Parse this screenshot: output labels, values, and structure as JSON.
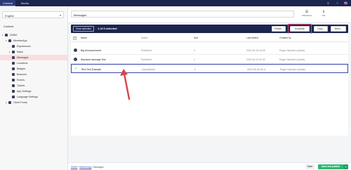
{
  "topbar": {
    "tabs": [
      "Content",
      "Media"
    ],
    "user_initials": "RH"
  },
  "sidebar": {
    "language": "English",
    "section_title": "Content",
    "items": [
      {
        "label": "DMNX"
      },
      {
        "label": "MemberApp"
      },
      {
        "label": "Experiences"
      },
      {
        "label": "Maps"
      },
      {
        "label": "Messages"
      },
      {
        "label": "Locations"
      },
      {
        "label": "Badges"
      },
      {
        "label": "Beacons"
      },
      {
        "label": "Events"
      },
      {
        "label": "Tickets"
      },
      {
        "label": "App Settings"
      },
      {
        "label": "Language Settings"
      },
      {
        "label": "Client Portal"
      }
    ]
  },
  "header": {
    "node_name": "Messages",
    "child_items_label": "Child items",
    "info_label": "Info"
  },
  "selection_bar": {
    "clear_label": "Clear selection",
    "count_text": "1 of 3 selected",
    "actions": [
      "Publish...",
      "Unpublish",
      "Copy...",
      "Move..."
    ]
  },
  "table": {
    "columns": [
      "Name",
      "Status",
      "Sort",
      "Last edited",
      "Created by"
    ],
    "rows": [
      {
        "name": "Big Announcement!",
        "status": "Published",
        "sort": "0",
        "last_edited": "2022-05-18 16:05",
        "created_by": "Roger Hamilton (Admin)"
      },
      {
        "name": "Standard message Test",
        "status": "Published",
        "sort": "1",
        "last_edited": "2022-05-13 20:32",
        "created_by": "Roger Hamilton (Admin)"
      },
      {
        "name": "Rich Text Example",
        "status": "Unpublished",
        "sort": "2",
        "last_edited": "2022-08-08 16:11",
        "created_by": "Roger Hamilton (Admin)"
      }
    ]
  },
  "footer": {
    "breadcrumbs": [
      "DMNX",
      "MemberApp",
      "Messages"
    ],
    "save_label": "Save",
    "publish_label": "Save and publish"
  },
  "colors": {
    "topbar": "#1b264f",
    "selection_bar": "#1b264f",
    "highlight": "#e0457b",
    "arrow": "#d9434e",
    "publish": "#2bb673"
  }
}
